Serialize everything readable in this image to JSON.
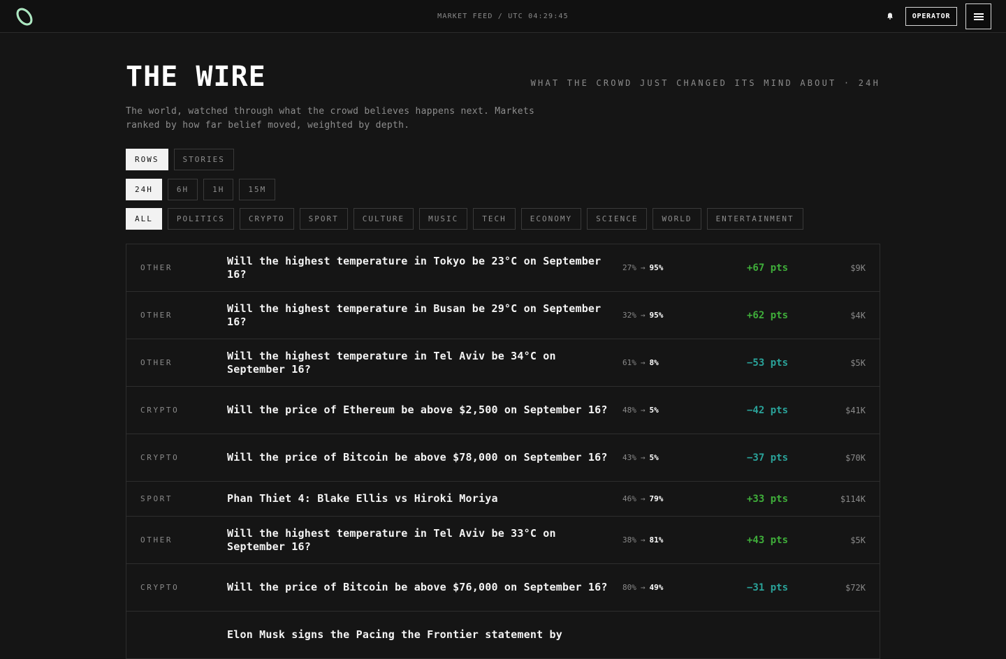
{
  "header": {
    "feed_text": "MARKET FEED / UTC 04:29:45",
    "operator_label": "OPERATOR",
    "logo_icon": "ring-logo-icon",
    "bell_icon": "bell-icon",
    "menu_icon": "hamburger-menu-icon"
  },
  "page": {
    "title": "THE WIRE",
    "tagline": "WHAT THE CROWD JUST CHANGED ITS MIND ABOUT · 24H",
    "description_line1": "The world, watched through what the crowd believes happens next. Markets",
    "description_line2": "ranked by how far belief moved, weighted by depth."
  },
  "view_tabs": [
    {
      "label": "ROWS",
      "active": true
    },
    {
      "label": "STORIES",
      "active": false
    }
  ],
  "time_tabs": [
    {
      "label": "24H",
      "active": true
    },
    {
      "label": "6H",
      "active": false
    },
    {
      "label": "1H",
      "active": false
    },
    {
      "label": "15M",
      "active": false
    }
  ],
  "category_tabs": [
    {
      "label": "ALL",
      "active": true
    },
    {
      "label": "POLITICS",
      "active": false
    },
    {
      "label": "CRYPTO",
      "active": false
    },
    {
      "label": "SPORT",
      "active": false
    },
    {
      "label": "CULTURE",
      "active": false
    },
    {
      "label": "MUSIC",
      "active": false
    },
    {
      "label": "TECH",
      "active": false
    },
    {
      "label": "ECONOMY",
      "active": false
    },
    {
      "label": "SCIENCE",
      "active": false
    },
    {
      "label": "WORLD",
      "active": false
    },
    {
      "label": "ENTERTAINMENT",
      "active": false
    }
  ],
  "colors": {
    "positive": "#3fae3a",
    "negative": "#2aa39a"
  },
  "markets": [
    {
      "category": "OTHER",
      "question": "Will the highest temperature in Tokyo be 23°C on September 16?",
      "from": "27%",
      "arrow": "→",
      "to": "95%",
      "delta": "+67 pts",
      "direction": "up",
      "volume": "$9K"
    },
    {
      "category": "OTHER",
      "question": "Will the highest temperature in Busan be 29°C on September 16?",
      "from": "32%",
      "arrow": "→",
      "to": "95%",
      "delta": "+62 pts",
      "direction": "up",
      "volume": "$4K"
    },
    {
      "category": "OTHER",
      "question": "Will the highest temperature in Tel Aviv be 34°C on September 16?",
      "from": "61%",
      "arrow": "→",
      "to": "8%",
      "delta": "−53 pts",
      "direction": "down",
      "volume": "$5K"
    },
    {
      "category": "CRYPTO",
      "question": "Will the price of Ethereum be above $2,500 on September 16?",
      "from": "48%",
      "arrow": "→",
      "to": "5%",
      "delta": "−42 pts",
      "direction": "down",
      "volume": "$41K"
    },
    {
      "category": "CRYPTO",
      "question": "Will the price of Bitcoin be above $78,000 on September 16?",
      "from": "43%",
      "arrow": "→",
      "to": "5%",
      "delta": "−37 pts",
      "direction": "down",
      "volume": "$70K"
    },
    {
      "category": "SPORT",
      "question": "Phan Thiet 4: Blake Ellis vs Hiroki Moriya",
      "from": "46%",
      "arrow": "→",
      "to": "79%",
      "delta": "+33 pts",
      "direction": "up",
      "volume": "$114K"
    },
    {
      "category": "OTHER",
      "question": "Will the highest temperature in Tel Aviv be 33°C on September 16?",
      "from": "38%",
      "arrow": "→",
      "to": "81%",
      "delta": "+43 pts",
      "direction": "up",
      "volume": "$5K"
    },
    {
      "category": "CRYPTO",
      "question": "Will the price of Bitcoin be above $76,000 on September 16?",
      "from": "80%",
      "arrow": "→",
      "to": "49%",
      "delta": "−31 pts",
      "direction": "down",
      "volume": "$72K"
    },
    {
      "category": "",
      "question": "Elon Musk signs the Pacing the Frontier statement by",
      "from": "",
      "arrow": "",
      "to": "",
      "delta": "",
      "direction": "up",
      "volume": ""
    }
  ]
}
